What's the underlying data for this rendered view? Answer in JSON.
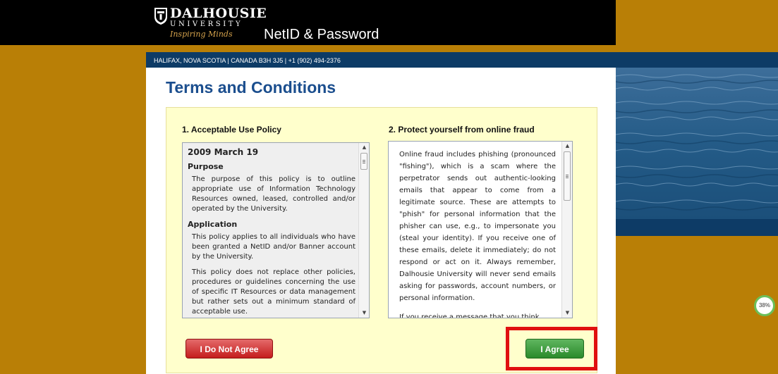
{
  "header": {
    "logo_name": "DALHOUSIE",
    "logo_university": "UNIVERSITY",
    "logo_tagline": "Inspiring Minds",
    "app_title": "NetID & Password"
  },
  "address": "HALIFAX, NOVA SCOTIA | CANADA B3H 3J5 | +1 (902) 494-2376",
  "page_title": "Terms and Conditions",
  "acceptable_use": {
    "heading": "1. Acceptable Use Policy",
    "date": "2009 March 19",
    "purpose_heading": "Purpose",
    "purpose_text": "The purpose of this policy is to outline appropriate use of Information Technology Resources owned, leased, controlled and/or operated by the University.",
    "application_heading": "Application",
    "application_text_1": "This policy applies to all individuals who have been granted a NetID and/or Banner account by the University.",
    "application_text_2": "This policy does not replace other policies, procedures or guidelines concerning the use of specific IT Resources or data management but rather sets out a minimum standard of acceptable use."
  },
  "fraud": {
    "heading": "2. Protect yourself from online fraud",
    "para_1": "Online fraud includes phishing (pronounced \"fishing\"), which is a scam where the perpetrator sends out authentic-looking emails that appear to come from a legitimate source. These are attempts to \"phish\" for personal information that the phisher can use, e.g., to impersonate you (steal your identity). If you receive one of these emails, delete it immediately; do not respond or act on it. Always remember, Dalhousie University will never send emails asking for passwords, account numbers, or personal information.",
    "para_2": "If you receive a message that you think"
  },
  "buttons": {
    "disagree": "I Do Not Agree",
    "agree": "I Agree"
  },
  "progress_badge": "38%",
  "colors": {
    "background_gold": "#b97f06",
    "navy": "#0d3b66",
    "title_blue": "#1b4e8e",
    "panel_yellow": "#ffffcc",
    "red_button": "#c41d1d",
    "green_button": "#2b8a2b",
    "highlight": "#e01010"
  }
}
